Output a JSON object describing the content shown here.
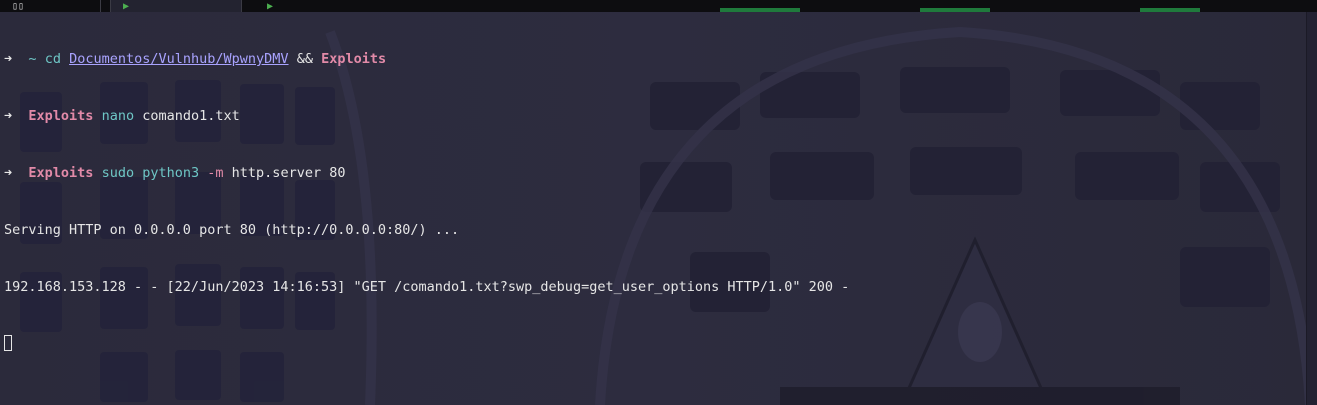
{
  "tabs": [
    {
      "icon": "split-pane-icon",
      "glyph": "▯▯"
    },
    {
      "icon": "play-icon",
      "glyph": "▶"
    },
    {
      "icon": "play-icon",
      "glyph": "▶"
    }
  ],
  "colors": {
    "background": "#2b2a3b",
    "prompt_dir": "#e28aa8",
    "command": "#6ec6c6",
    "path": "#a9a3ff",
    "text": "#e6e6e6"
  },
  "terminal": {
    "lines": [
      {
        "arrow": "➜",
        "cwd": "~",
        "command": "cd",
        "path": "Documentos/Vulnhub/WpwnyDMV",
        "op": "&&",
        "arg2": "Exploits"
      },
      {
        "arrow": "➜",
        "cwd": "Exploits",
        "command": "nano",
        "arg": "comando1.txt"
      },
      {
        "arrow": "➜",
        "cwd": "Exploits",
        "command": "sudo python3",
        "flag": "-m",
        "arg": "http.server 80"
      },
      {
        "output": "Serving HTTP on 0.0.0.0 port 80 (http://0.0.0.0:80/) ..."
      },
      {
        "output": "192.168.153.128 - - [22/Jun/2023 14:16:53] \"GET /comando1.txt?swp_debug=get_user_options HTTP/1.0\" 200 -"
      }
    ]
  }
}
